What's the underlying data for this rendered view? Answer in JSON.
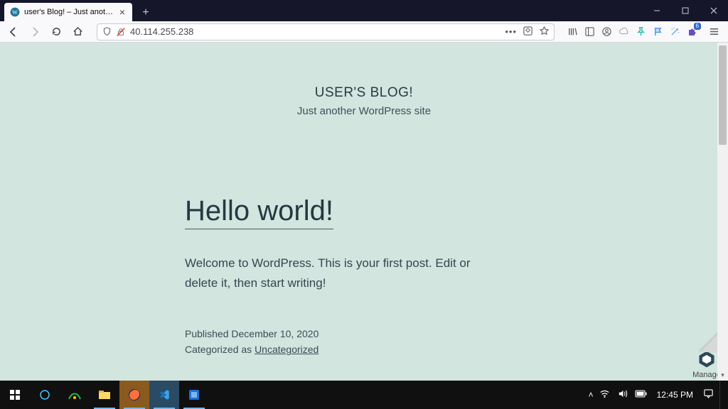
{
  "browser": {
    "tab_title": "user's Blog! – Just another Wo",
    "address": "40.114.255.238",
    "ext_badge": "6"
  },
  "site": {
    "title": "USER'S BLOG!",
    "tagline": "Just another WordPress site"
  },
  "post": {
    "title": "Hello world!",
    "body": "Welcome to WordPress. This is your first post. Edit or delete it, then start writing!",
    "published_label": "Published",
    "published_date": "December 10, 2020",
    "categorized_label": "Categorized as",
    "category": "Uncategorized"
  },
  "bitnami": {
    "label": "Manage"
  },
  "taskbar": {
    "clock": "12:45 PM"
  }
}
